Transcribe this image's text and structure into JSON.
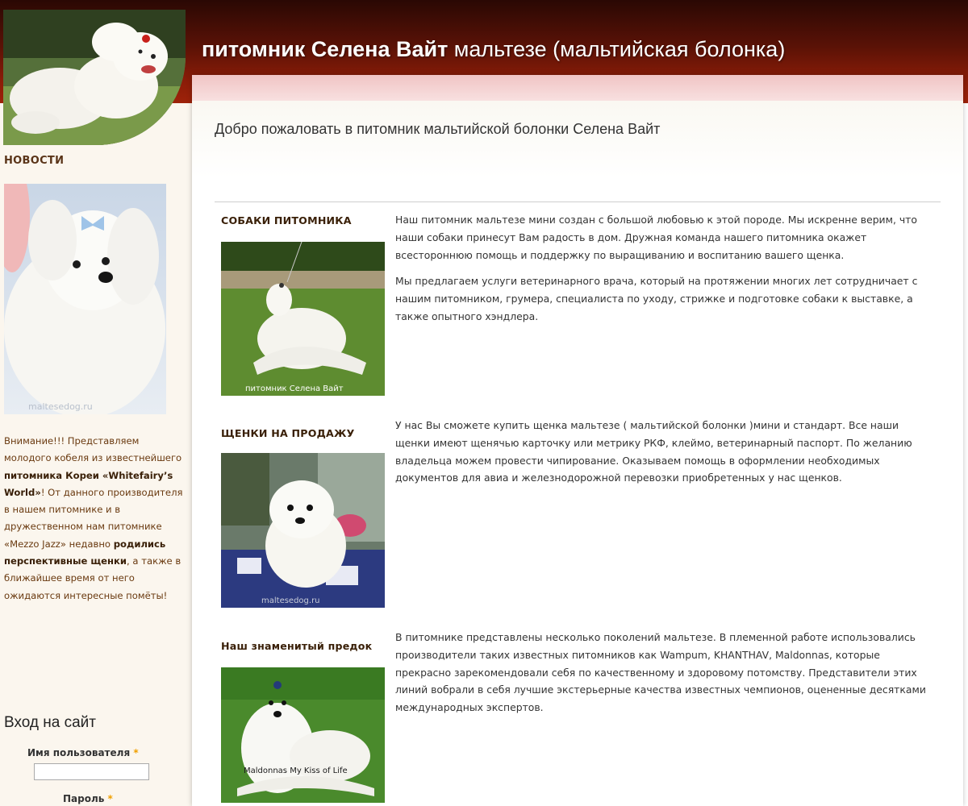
{
  "site": {
    "title_bold": "питомник Селена Вайт",
    "title_rest": " мальтезе (мальтийская болонка)"
  },
  "sidebar": {
    "news_title": "НОВОСТИ",
    "news_text_parts": [
      "Внимание!!! Представляем молодого кобеля из известнейшего ",
      "питомника Кореи «Whitefairy’s World»",
      "! От данного производителя в нашем питомнике и в дружественном нам питомнике «Mezzo Jazz» недавно ",
      "родились перспективные щенки",
      ", а также в ближайшее время от него ожидаются интересные помёты!"
    ],
    "photo_watermark": "maltesedog.ru",
    "login": {
      "title": "Вход на сайт",
      "username_label": "Имя пользователя",
      "password_label": "Пароль",
      "required_mark": "*"
    }
  },
  "main": {
    "welcome": "Добро пожаловать в питомник мальтийской болонки Селена Вайт",
    "sections": [
      {
        "title": "СОБАКИ ПИТОМНИКА",
        "caption": "питомник Селена Вайт",
        "paragraphs": [
          "Наш питомник мальтезе мини создан с большой любовью к этой породе. Мы искренне верим, что наши собаки принесут Вам радость в дом. Дружная команда нашего питомника окажет всестороннюю помощь и поддержку по выращиванию и воспитанию вашего щенка.",
          "Мы предлагаем услуги ветеринарного врача, который на протяжении многих лет сотрудничает с нашим питомником, грумера, специалиста по уходу, стрижке и подготовке собаки к выставке, а также опытного хэндлера."
        ]
      },
      {
        "title": "ЩЕНКИ НА ПРОДАЖУ",
        "caption": "maltesedog.ru",
        "paragraphs": [
          "У нас Вы сможете купить щенка мальтезе ( мальтийской болонки )мини и стандарт. Все наши щенки имеют щенячью карточку или метрику РКФ, клеймо, ветеринарный паспорт. По желанию владельца можем провести чипирование. Оказываем помощь в оформлении необходимых документов для авиа и железнодорожной перевозки приобретенных у нас щенков."
        ]
      },
      {
        "title": "Наш знаменитый предок",
        "caption": "Maldonnas My Kiss of Life",
        "paragraphs": [
          "В питомнике представлены несколько поколений мальтезе. В племенной работе использовались производители таких известных питомников как Wampum, KHANTHAV, Maldonnas, которые прекрасно зарекомендовали себя по качественному и здоровому потомству. Представители этих линий вобрали в себя лучшие экстерьерные качества известных чемпионов, оцененные десятками международных экспертов."
        ]
      }
    ]
  },
  "colors": {
    "header_dark": "#2a0804",
    "header_red": "#9e2209",
    "sidebar_bg": "#fbf6ee",
    "news_text": "#6a3a10",
    "band_pink": "#f0c4c4"
  }
}
